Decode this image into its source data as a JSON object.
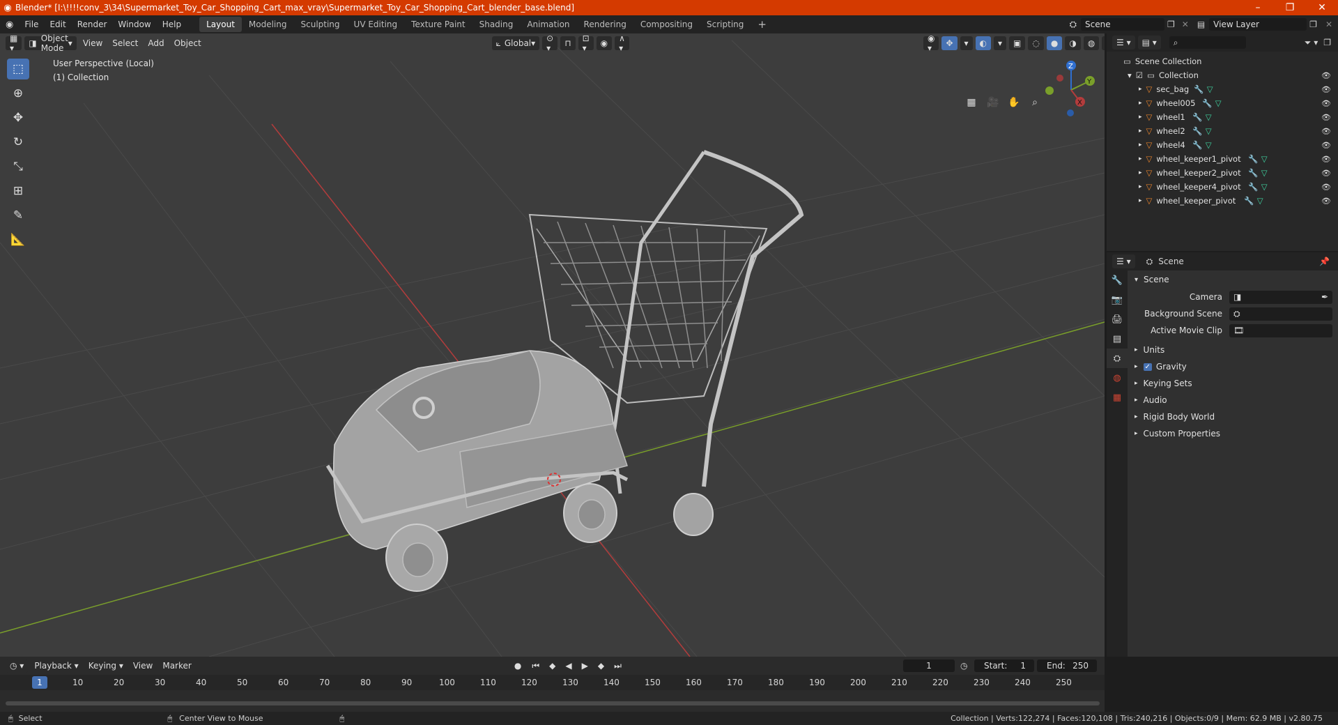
{
  "window": {
    "title": "Blender* [I:\\!!!!conv_3\\34\\Supermarket_Toy_Car_Shopping_Cart_max_vray\\Supermarket_Toy_Car_Shopping_Cart_blender_base.blend]",
    "logo_icon": "blender-logo-icon",
    "minimize": "–",
    "maximize": "❐",
    "close": "✕"
  },
  "menu": {
    "items": [
      "File",
      "Edit",
      "Render",
      "Window",
      "Help"
    ]
  },
  "workspaces": {
    "tabs": [
      "Layout",
      "Modeling",
      "Sculpting",
      "UV Editing",
      "Texture Paint",
      "Shading",
      "Animation",
      "Rendering",
      "Compositing",
      "Scripting"
    ],
    "active": "Layout",
    "add": "+"
  },
  "scene_selector": {
    "value": "Scene"
  },
  "view_layer": {
    "value": "View Layer"
  },
  "viewport": {
    "mode": "Object Mode",
    "menus": [
      "View",
      "Select",
      "Add",
      "Object"
    ],
    "orientation": "Global",
    "overlay_text_1": "User Perspective (Local)",
    "overlay_text_2": "(1) Collection",
    "gizmo": {
      "x": "X",
      "y": "Y",
      "z": "Z"
    }
  },
  "outliner": {
    "root": "Scene Collection",
    "collection": "Collection",
    "objects": [
      "sec_bag",
      "wheel005",
      "wheel1",
      "wheel2",
      "wheel4",
      "wheel_keeper1_pivot",
      "wheel_keeper2_pivot",
      "wheel_keeper4_pivot",
      "wheel_keeper_pivot"
    ]
  },
  "properties": {
    "header": "Scene",
    "section": "Scene",
    "fields": {
      "camera": "Camera",
      "background_scene": "Background Scene",
      "active_movie_clip": "Active Movie Clip"
    },
    "subpanels": [
      "Units",
      "Gravity",
      "Keying Sets",
      "Audio",
      "Rigid Body World",
      "Custom Properties"
    ]
  },
  "timeline": {
    "menus": [
      "Playback",
      "Keying",
      "View",
      "Marker"
    ],
    "current_frame": "1",
    "start_label": "Start:",
    "start": "1",
    "end_label": "End:",
    "end": "250",
    "ticks": [
      "1",
      "10",
      "20",
      "30",
      "40",
      "50",
      "60",
      "70",
      "80",
      "90",
      "100",
      "110",
      "120",
      "130",
      "140",
      "150",
      "160",
      "170",
      "180",
      "190",
      "200",
      "210",
      "220",
      "230",
      "240",
      "250"
    ]
  },
  "status": {
    "left_action": "Select",
    "mid_action": "Center View to Mouse",
    "stats": "Collection | Verts:122,274 | Faces:120,108 | Tris:240,216 | Objects:0/9 | Mem: 62.9 MB | v2.80.75"
  },
  "colors": {
    "title_bar": "#d43a00",
    "accent": "#4772b3",
    "x_axis": "#b33c3c",
    "y_axis": "#7a9f2a",
    "z_axis": "#2f6fd0",
    "mesh_orange": "#e8832b",
    "modifier_blue": "#6f9ee6",
    "mesh_data_green": "#3fd3a1"
  }
}
